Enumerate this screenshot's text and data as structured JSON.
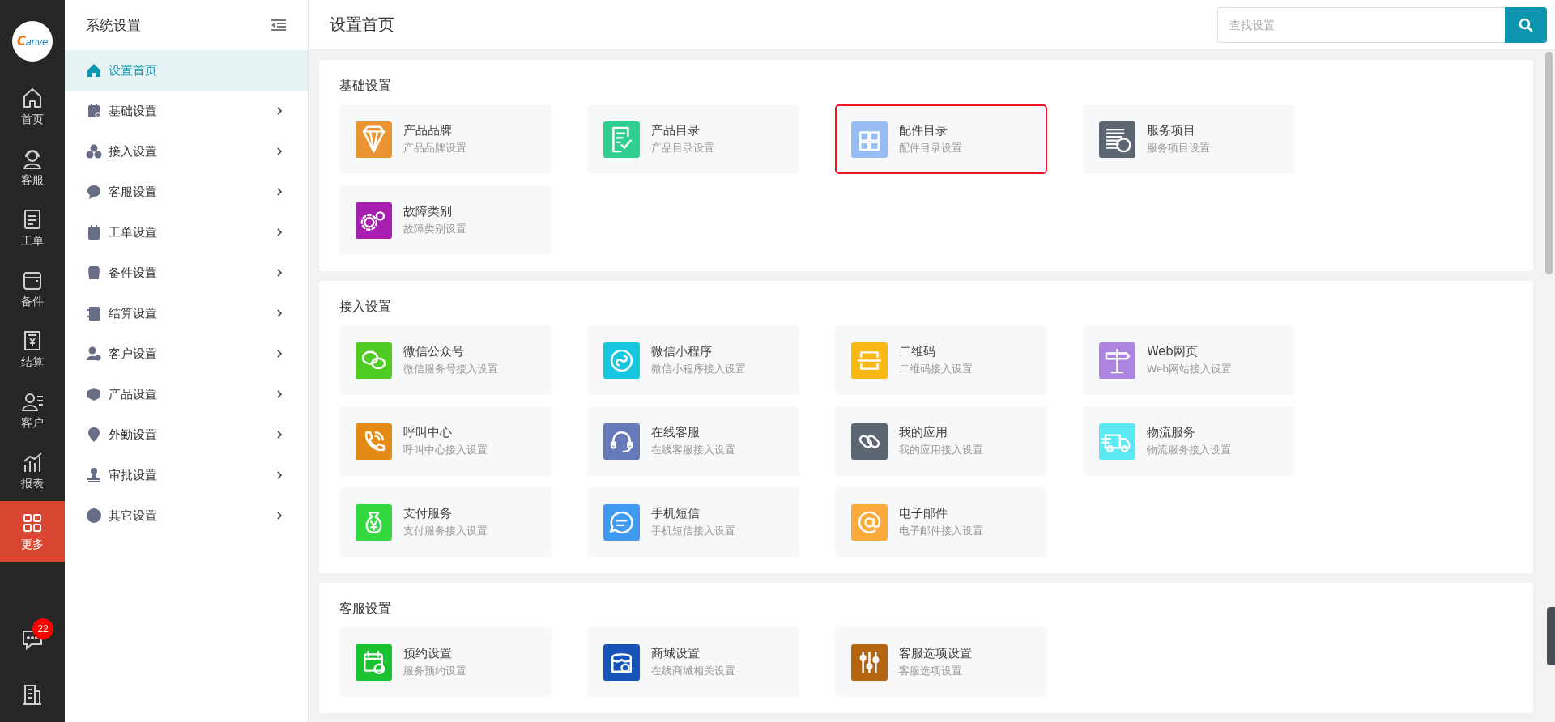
{
  "logo": "Canve",
  "nav": [
    {
      "label": "首页",
      "selected": false
    },
    {
      "label": "客服",
      "selected": false
    },
    {
      "label": "工单",
      "selected": false
    },
    {
      "label": "备件",
      "selected": false
    },
    {
      "label": "结算",
      "selected": false
    },
    {
      "label": "客户",
      "selected": false
    },
    {
      "label": "报表",
      "selected": false
    },
    {
      "label": "更多",
      "selected": true
    }
  ],
  "chat_badge": "22",
  "sidebar": {
    "title": "系统设置",
    "items": [
      {
        "label": "设置首页",
        "selected": true,
        "expandable": false
      },
      {
        "label": "基础设置",
        "selected": false,
        "expandable": true
      },
      {
        "label": "接入设置",
        "selected": false,
        "expandable": true
      },
      {
        "label": "客服设置",
        "selected": false,
        "expandable": true
      },
      {
        "label": "工单设置",
        "selected": false,
        "expandable": true
      },
      {
        "label": "备件设置",
        "selected": false,
        "expandable": true
      },
      {
        "label": "结算设置",
        "selected": false,
        "expandable": true
      },
      {
        "label": "客户设置",
        "selected": false,
        "expandable": true
      },
      {
        "label": "产品设置",
        "selected": false,
        "expandable": true
      },
      {
        "label": "外勤设置",
        "selected": false,
        "expandable": true
      },
      {
        "label": "审批设置",
        "selected": false,
        "expandable": true
      },
      {
        "label": "其它设置",
        "selected": false,
        "expandable": true
      }
    ]
  },
  "page_title": "设置首页",
  "search": {
    "placeholder": "查找设置"
  },
  "sections": [
    {
      "title": "基础设置",
      "cards": [
        {
          "title": "产品品牌",
          "subtitle": "产品品牌设置",
          "color": "#ec9433",
          "highlighted": false
        },
        {
          "title": "产品目录",
          "subtitle": "产品目录设置",
          "color": "#2ecf8f",
          "highlighted": false
        },
        {
          "title": "配件目录",
          "subtitle": "配件目录设置",
          "color": "#98bdf5",
          "highlighted": true
        },
        {
          "title": "服务项目",
          "subtitle": "服务项目设置",
          "color": "#5b6672",
          "highlighted": false
        },
        {
          "title": "故障类别",
          "subtitle": "故障类别设置",
          "color": "#a61fb0",
          "highlighted": false
        }
      ]
    },
    {
      "title": "接入设置",
      "cards": [
        {
          "title": "微信公众号",
          "subtitle": "微信服务号接入设置",
          "color": "#4fcc23",
          "highlighted": false
        },
        {
          "title": "微信小程序",
          "subtitle": "微信小程序接入设置",
          "color": "#17c6e0",
          "highlighted": false
        },
        {
          "title": "二维码",
          "subtitle": "二维码接入设置",
          "color": "#fbb714",
          "highlighted": false
        },
        {
          "title": "Web网页",
          "subtitle": "Web网站接入设置",
          "color": "#ad84e0",
          "highlighted": false
        },
        {
          "title": "呼叫中心",
          "subtitle": "呼叫中心接入设置",
          "color": "#e38b14",
          "highlighted": false
        },
        {
          "title": "在线客服",
          "subtitle": "在线客服接入设置",
          "color": "#6679b8",
          "highlighted": false
        },
        {
          "title": "我的应用",
          "subtitle": "我的应用接入设置",
          "color": "#5b6672",
          "highlighted": false
        },
        {
          "title": "物流服务",
          "subtitle": "物流服务接入设置",
          "color": "#5ce8f2",
          "highlighted": false
        },
        {
          "title": "支付服务",
          "subtitle": "支付服务接入设置",
          "color": "#33d93f",
          "highlighted": false
        },
        {
          "title": "手机短信",
          "subtitle": "手机短信接入设置",
          "color": "#3f9af0",
          "highlighted": false
        },
        {
          "title": "电子邮件",
          "subtitle": "电子邮件接入设置",
          "color": "#fbab3c",
          "highlighted": false
        }
      ]
    },
    {
      "title": "客服设置",
      "cards": [
        {
          "title": "预约设置",
          "subtitle": "服务预约设置",
          "color": "#1bc230",
          "highlighted": false
        },
        {
          "title": "商城设置",
          "subtitle": "在线商城相关设置",
          "color": "#1652b8",
          "highlighted": false
        },
        {
          "title": "客服选项设置",
          "subtitle": "客服选项设置",
          "color": "#b5650f",
          "highlighted": false
        }
      ]
    }
  ]
}
